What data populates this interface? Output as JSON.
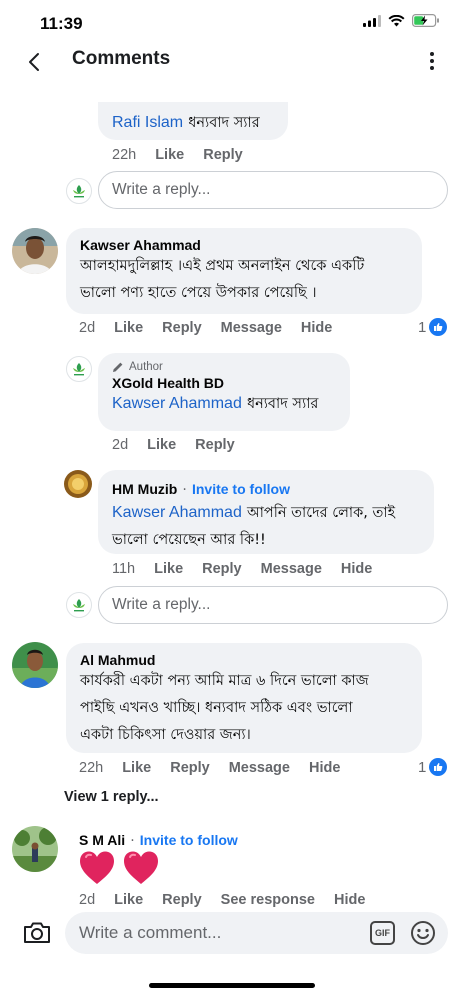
{
  "status_bar": {
    "time": "11:39"
  },
  "header": {
    "title": "Comments"
  },
  "comments": {
    "rafi": {
      "name": "Rafi Islam",
      "text": "ধন্যবাদ স্যার",
      "time": "22h",
      "like": "Like",
      "reply": "Reply"
    },
    "reply_placeholder": "Write a reply...",
    "kawser": {
      "name": "Kawser Ahammad",
      "line1": "আলহামদুলিল্লাহ ।এই প্রথম অনলাইন থেকে একটি",
      "line2": "ভালো পণ্য হাতে পেয়ে উপকার পেয়েছি ।",
      "time": "2d",
      "like": "Like",
      "reply": "Reply",
      "message": "Message",
      "hide": "Hide",
      "likes": "1"
    },
    "xgold": {
      "author_tag": "Author",
      "name": "XGold Health BD",
      "mention": "Kawser Ahammad",
      "text": "ধন্যবাদ স্যার",
      "time": "2d",
      "like": "Like",
      "reply": "Reply"
    },
    "muzib": {
      "name": "HM Muzib",
      "dot": "·",
      "follow": "Invite to follow",
      "mention": "Kawser Ahammad",
      "line1_rest": "আপনি তাদের লোক, তাই",
      "line2": "ভালো পেয়েছেন আর কি!!",
      "time": "11h",
      "like": "Like",
      "reply": "Reply",
      "message": "Message",
      "hide": "Hide"
    },
    "al": {
      "name": "Al Mahmud",
      "line1": "কার্যকরী একটা পন্য আমি মাত্র ৬ দিনে ভালো কাজ",
      "line2": "পাইছি এখনও খাচ্ছি। ধন্যবাদ সঠিক এবং ভালো",
      "line3": "একটা চিকিৎসা দেওয়ার জন্য।",
      "time": "22h",
      "like": "Like",
      "reply": "Reply",
      "message": "Message",
      "hide": "Hide",
      "likes": "1"
    },
    "view_replies": "View 1 reply...",
    "sm": {
      "name": "S M Ali",
      "dot": "·",
      "follow": "Invite to follow",
      "time": "2d",
      "like": "Like",
      "reply": "Reply",
      "see_response": "See response",
      "hide": "Hide"
    }
  },
  "composer": {
    "placeholder": "Write a comment...",
    "gif": "GIF"
  },
  "icons": {
    "back": "chevron-left-icon",
    "more": "more-vertical-icon",
    "camera": "camera-icon",
    "gif": "gif-icon",
    "emoji": "emoji-icon",
    "like_badge": "thumbs-up-icon",
    "heart": "heart-icon"
  },
  "colors": {
    "accent": "#1877f2",
    "mention": "#1d63c8",
    "bubble": "#f0f2f5",
    "muted": "#65676b",
    "heart": "#e0245e"
  }
}
